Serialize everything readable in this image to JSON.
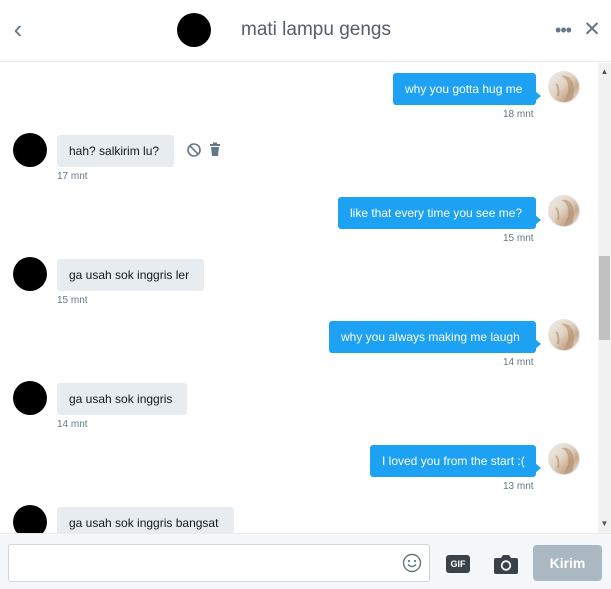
{
  "header": {
    "title": "mati lampu gengs",
    "back_icon": "chevron-left-icon",
    "more_icon": "more-dots-icon",
    "close_icon": "close-icon"
  },
  "messages": [
    {
      "sender": "me",
      "text": "why you gotta hug me",
      "time": "18 mnt"
    },
    {
      "sender": "other",
      "text": "hah? salkirim lu?",
      "time": "17 mnt",
      "actions": [
        "block-icon",
        "trash-icon"
      ]
    },
    {
      "sender": "me",
      "text": "like that every time you see me?",
      "time": "15 mnt"
    },
    {
      "sender": "other",
      "text": "ga usah sok inggris ler",
      "time": "15 mnt"
    },
    {
      "sender": "me",
      "text": "why you always making me laugh",
      "time": "14 mnt"
    },
    {
      "sender": "other",
      "text": "ga usah sok inggris",
      "time": "14 mnt"
    },
    {
      "sender": "me",
      "text": "I loved you from the start :(",
      "time": "13 mnt"
    },
    {
      "sender": "other",
      "text": "ga usah sok inggris bangsat",
      "time": ""
    }
  ],
  "composer": {
    "placeholder": "",
    "gif_label": "GIF",
    "send_label": "Kirim",
    "emoji_icon": "emoji-smiley-icon",
    "camera_icon": "camera-icon"
  },
  "colors": {
    "accent": "#1da1f2",
    "received_bubble": "#e6ecf0",
    "send_disabled": "#aab8c2",
    "muted_text": "#657786"
  }
}
